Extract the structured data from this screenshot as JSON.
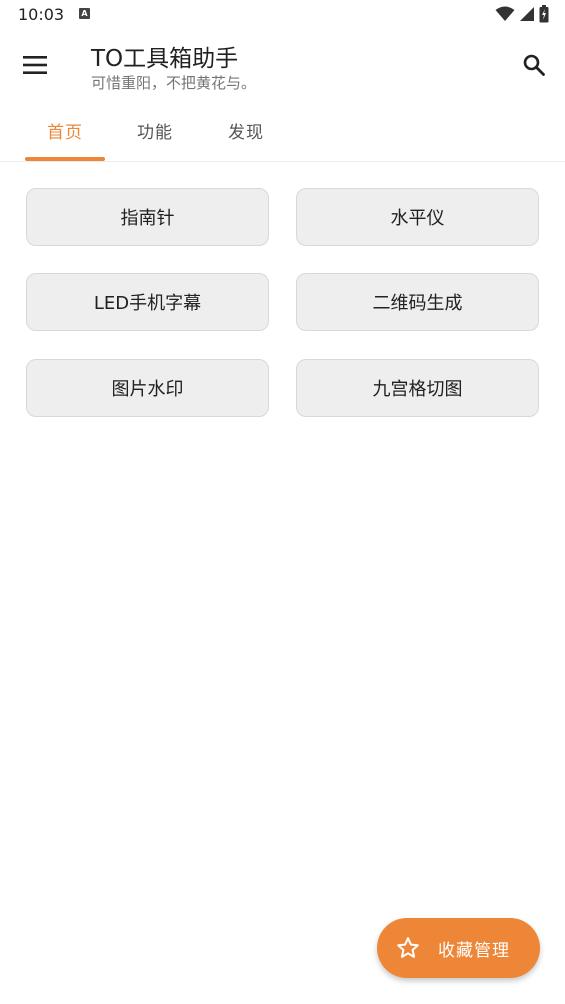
{
  "status_bar": {
    "time": "10:03",
    "notification_icon": "A"
  },
  "app_bar": {
    "title": "TO工具箱助手",
    "subtitle": "可惜重阳，不把黄花与。"
  },
  "tabs": [
    {
      "label": "首页",
      "active": true
    },
    {
      "label": "功能",
      "active": false
    },
    {
      "label": "发现",
      "active": false
    }
  ],
  "tools": [
    {
      "label": "指南针"
    },
    {
      "label": "水平仪"
    },
    {
      "label": "LED手机字幕"
    },
    {
      "label": "二维码生成"
    },
    {
      "label": "图片水印"
    },
    {
      "label": "九宫格切图"
    }
  ],
  "fab": {
    "label": "收藏管理",
    "icon": "star-outline-icon"
  },
  "colors": {
    "accent": "#ED8637",
    "button_bg": "#eeeeee"
  }
}
